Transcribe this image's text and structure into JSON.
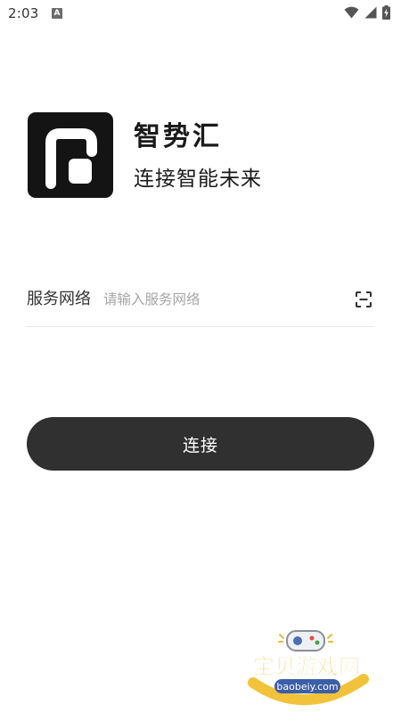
{
  "status_bar": {
    "time": "2:03",
    "notification_icon_letter": "A",
    "icons": [
      "wifi-icon",
      "signal-icon",
      "battery-charging-icon"
    ]
  },
  "brand": {
    "logo_icon": "app-logo-icon",
    "name": "智势汇",
    "slogan": "连接智能未来",
    "logo_color": "#141414"
  },
  "server_field": {
    "label": "服务网络",
    "placeholder": "请输入服务网络",
    "value": "",
    "scan_icon": "scan-icon"
  },
  "connect_button": {
    "label": "连接",
    "color": "#303030"
  },
  "watermark": {
    "title": "宝贝游戏网",
    "url": "baobeiy.com"
  }
}
